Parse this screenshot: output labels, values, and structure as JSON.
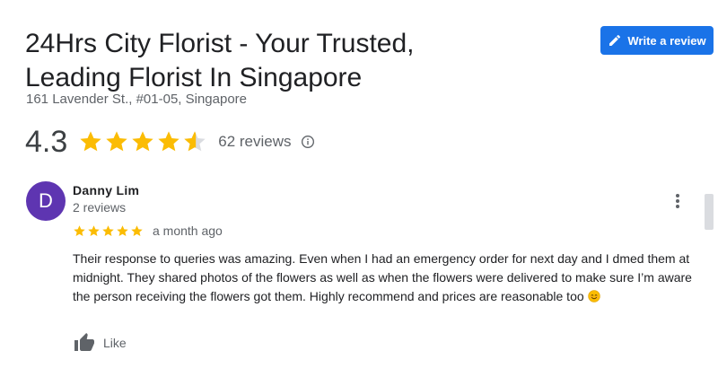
{
  "business": {
    "title_line1": "24Hrs City Florist - Your Trusted,",
    "title_line2": "Leading Florist In Singapore",
    "address": "161 Lavender St., #01-05, Singapore"
  },
  "write_review": {
    "label": "Write a review",
    "icon": "pencil-icon",
    "color": "#1a73e8"
  },
  "rating": {
    "value": "4.3",
    "stars_filled": 4.3,
    "stars_max": 5,
    "review_count": "62 reviews",
    "star_color": "#fbbc04"
  },
  "review": {
    "avatar_letter": "D",
    "avatar_color": "#5e35b1",
    "reviewer_name": "Danny Lim",
    "reviewer_meta": "2 reviews",
    "stars": 5,
    "date": "a month ago",
    "text": "Their response to queries was amazing. Even when I had an emergency order for next day and I dmed them at midnight. They shared photos of the flowers as well as when the flowers were delivered to make sure I’m aware the person receiving the flowers got them. Highly recommend and prices are reasonable too",
    "emoji": "smiling-face-icon",
    "like_label": "Like"
  }
}
